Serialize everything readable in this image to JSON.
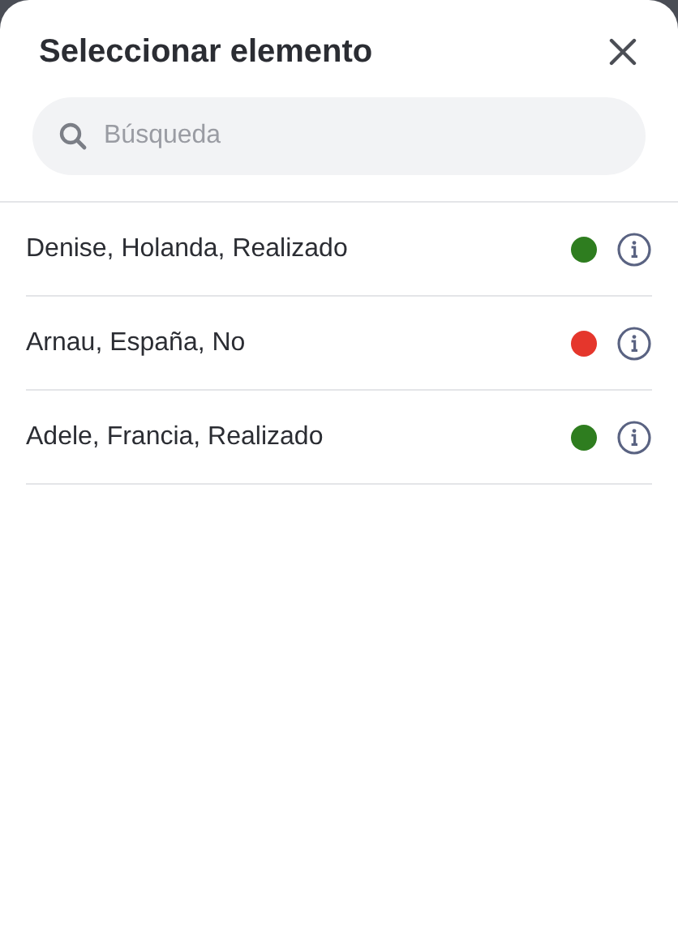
{
  "title": "Seleccionar elemento",
  "search": {
    "placeholder": "Búsqueda"
  },
  "items": [
    {
      "label": "Denise, Holanda, Realizado",
      "color": "#2e7d1f"
    },
    {
      "label": "Arnau, España, No",
      "color": "#e5362c"
    },
    {
      "label": "Adele, Francia, Realizado",
      "color": "#2e7d1f"
    }
  ]
}
